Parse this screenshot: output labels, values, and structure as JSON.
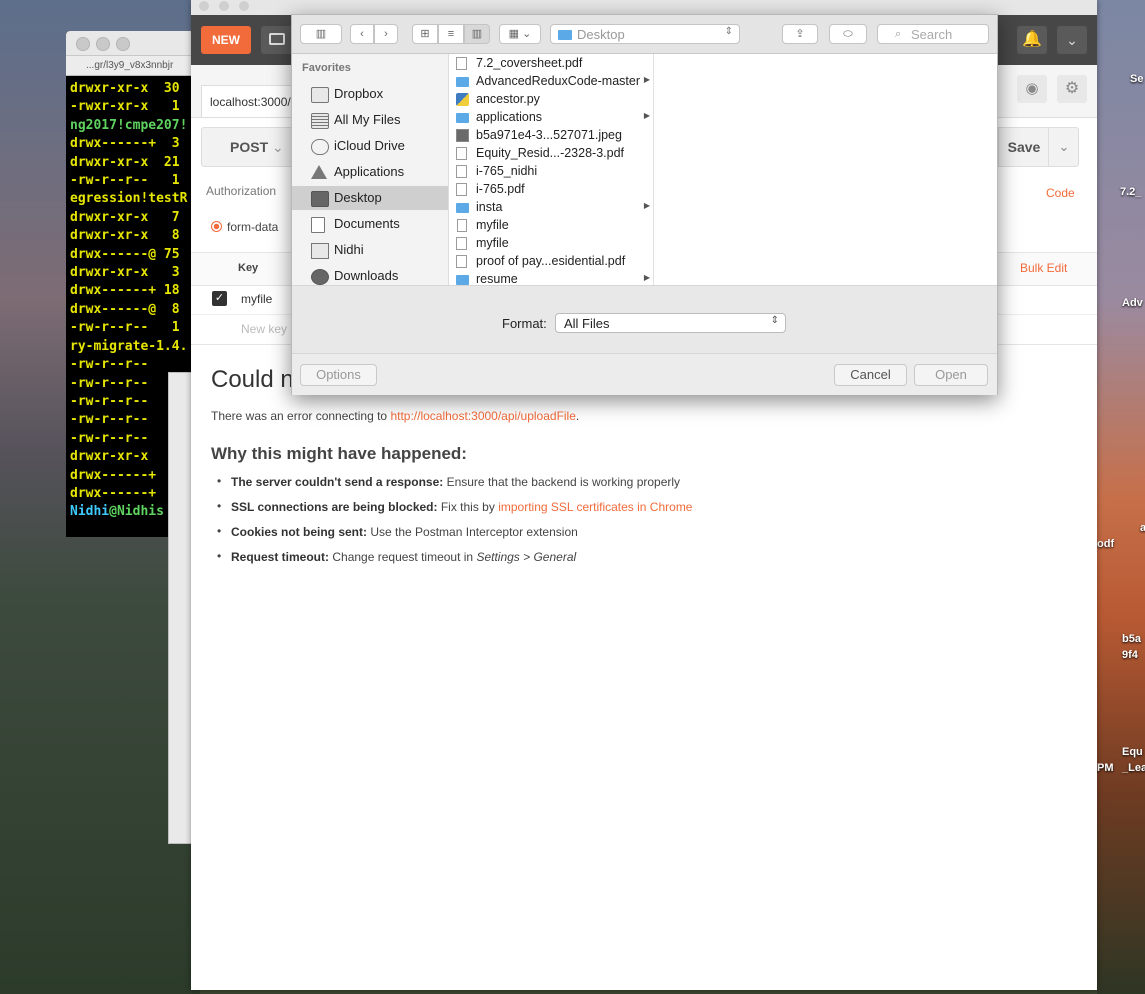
{
  "desktop": {
    "labels": [
      "Se",
      "7.2_",
      "Adv",
      "a",
      "odf",
      "b5a",
      "9f4",
      "Equ",
      "_Lea",
      "PM"
    ]
  },
  "terminal": {
    "title": "...gr/l3y9_v8x3nnbjr",
    "lines": [
      {
        "text": "drwxr-xr-x  30",
        "color": "yellow"
      },
      {
        "text": "-rwxr-xr-x   1",
        "color": "yellow"
      },
      {
        "text": "ng2017!cmpe207!",
        "color": "green"
      },
      {
        "text": "drwx------+  3",
        "color": "yellow"
      },
      {
        "text": "drwxr-xr-x  21",
        "color": "yellow"
      },
      {
        "text": "-rw-r--r--   1",
        "color": "yellow"
      },
      {
        "text": "egression!testR",
        "color": "yellow"
      },
      {
        "text": "drwxr-xr-x   7",
        "color": "yellow"
      },
      {
        "text": "drwxr-xr-x   8",
        "color": "yellow"
      },
      {
        "text": "drwx------@ 75",
        "color": "yellow"
      },
      {
        "text": "drwxr-xr-x   3",
        "color": "yellow"
      },
      {
        "text": "drwx------+ 18",
        "color": "yellow"
      },
      {
        "text": "drwx------@  8",
        "color": "yellow"
      },
      {
        "text": "-rw-r--r--   1",
        "color": "yellow"
      },
      {
        "text": "ry-migrate-1.4.",
        "color": "yellow"
      },
      {
        "text": "-rw-r--r--",
        "color": "yellow"
      },
      {
        "text": "-rw-r--r--",
        "color": "yellow"
      },
      {
        "text": "-rw-r--r--",
        "color": "yellow"
      },
      {
        "text": "-rw-r--r--",
        "color": "yellow"
      },
      {
        "text": "-rw-r--r--",
        "color": "yellow"
      },
      {
        "text": "drwxr-xr-x",
        "color": "yellow"
      },
      {
        "text": "drwx------+",
        "color": "yellow"
      },
      {
        "text": "drwx------+",
        "color": "yellow"
      }
    ],
    "prompt_user": "Nidhi",
    "prompt_host": "@Nidhis"
  },
  "postman": {
    "new_label": "NEW",
    "tab_url": "localhost:3000/a",
    "method": "POST",
    "save_label": "Save",
    "auth_label": "Authorization",
    "code_label": "Code",
    "form_data_label": "form-data",
    "key_header": "Key",
    "bulk_edit_label": "Bulk Edit",
    "row_key": "myfile",
    "new_key_placeholder": "New key",
    "error_title": "Could n",
    "error_prefix": "There was an error connecting to ",
    "error_url": "http://localhost:3000/api/uploadFile",
    "error_suffix": ".",
    "why_title": "Why this might have happened:",
    "reasons": [
      {
        "label": "The server couldn't send a response:",
        "text": " Ensure that the backend is working properly",
        "link": "",
        "italic": ""
      },
      {
        "label": "SSL connections are being blocked:",
        "text": " Fix this by ",
        "link": "importing SSL certificates in Chrome",
        "italic": ""
      },
      {
        "label": "Cookies not being sent:",
        "text": " Use the Postman Interceptor extension",
        "link": "",
        "italic": ""
      },
      {
        "label": "Request timeout:",
        "text": " Change request timeout in ",
        "link": "",
        "italic": "Settings > General"
      }
    ],
    "accent_color": "#f26b3a"
  },
  "dialog": {
    "location": "Desktop",
    "search_placeholder": "Search",
    "favorites_header": "Favorites",
    "favorites": [
      {
        "label": "Dropbox",
        "icon": "dropbox-folder-icon",
        "selected": false
      },
      {
        "label": "All My Files",
        "icon": "all-files-icon",
        "selected": false
      },
      {
        "label": "iCloud Drive",
        "icon": "cloud-icon",
        "selected": false
      },
      {
        "label": "Applications",
        "icon": "applications-icon",
        "selected": false
      },
      {
        "label": "Desktop",
        "icon": "desktop-icon",
        "selected": true
      },
      {
        "label": "Documents",
        "icon": "documents-icon",
        "selected": false
      },
      {
        "label": "Nidhi",
        "icon": "home-icon",
        "selected": false
      },
      {
        "label": "Downloads",
        "icon": "downloads-icon",
        "selected": false
      }
    ],
    "files": [
      {
        "name": "7.2_coversheet.pdf",
        "type": "pdf",
        "folder": false
      },
      {
        "name": "AdvancedReduxCode-master",
        "type": "folder",
        "folder": true
      },
      {
        "name": "ancestor.py",
        "type": "py",
        "folder": false
      },
      {
        "name": "applications",
        "type": "folder",
        "folder": true
      },
      {
        "name": "b5a971e4-3...527071.jpeg",
        "type": "img",
        "folder": false
      },
      {
        "name": "Equity_Resid...-2328-3.pdf",
        "type": "pdf",
        "folder": false
      },
      {
        "name": "i-765_nidhi",
        "type": "pdf",
        "folder": false
      },
      {
        "name": "i-765.pdf",
        "type": "pdf",
        "folder": false
      },
      {
        "name": "insta",
        "type": "folder",
        "folder": true
      },
      {
        "name": "myfile",
        "type": "doc",
        "folder": false
      },
      {
        "name": "myfile",
        "type": "pdf",
        "folder": false
      },
      {
        "name": "proof of pay...esidential.pdf",
        "type": "pdf",
        "folder": false
      },
      {
        "name": "resume",
        "type": "folder",
        "folder": true
      }
    ],
    "format_label": "Format:",
    "format_value": "All Files",
    "options_label": "Options",
    "cancel_label": "Cancel",
    "open_label": "Open"
  }
}
